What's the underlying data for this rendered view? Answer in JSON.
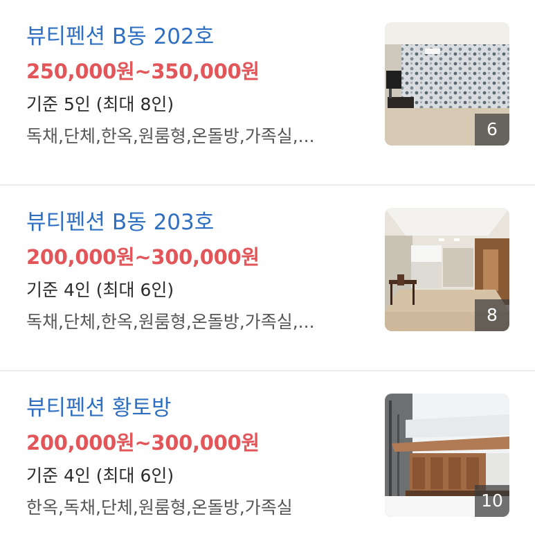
{
  "listings": [
    {
      "title": "뷰티펜션 B동 202호",
      "price": "250,000원~350,000원",
      "capacity": "기준 5인 (최대 8인)",
      "tags": "독채,단체,한옥,원룸형,온돌방,가족실,...",
      "photo_count": "6"
    },
    {
      "title": "뷰티펜션 B동 203호",
      "price": "200,000원~300,000원",
      "capacity": "기준 4인 (최대 6인)",
      "tags": "독채,단체,한옥,원룸형,온돌방,가족실,...",
      "photo_count": "8"
    },
    {
      "title": "뷰티펜션 황토방",
      "price": "200,000원~300,000원",
      "capacity": "기준 4인 (최대 6인)",
      "tags": "한옥,독채,단체,원룸형,온돌방,가족실",
      "photo_count": "10"
    }
  ],
  "colors": {
    "title": "#2f6fc1",
    "price": "#e2565a",
    "divider": "#ececec"
  }
}
